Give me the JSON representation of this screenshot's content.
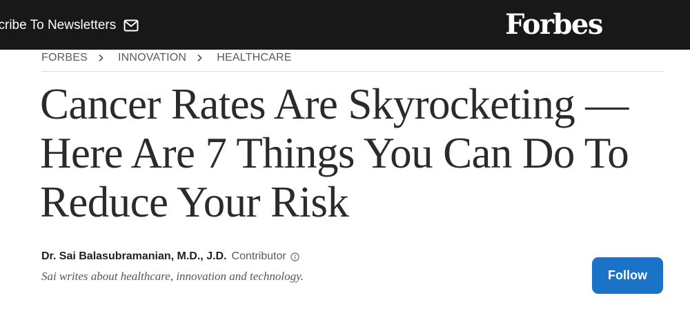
{
  "header": {
    "subscribe_label": "scribe To Newsletters",
    "mail_icon": "mail-icon",
    "logo_text": "Forbes"
  },
  "breadcrumb": {
    "items": [
      "FORBES",
      "INNOVATION",
      "HEALTHCARE"
    ],
    "separator_icon": "chevron-right-icon"
  },
  "article": {
    "headline": "Cancer Rates Are Skyrocketing — Here Are 7 Things You Can Do To Reduce Your Risk",
    "author_name": "Dr. Sai Balasubramanian, M.D., J.D.",
    "author_role": "Contributor",
    "info_icon": "info-icon",
    "author_bio": "Sai writes about healthcare, innovation and technology.",
    "follow_label": "Follow"
  },
  "colors": {
    "header_background": "#181818",
    "follow_button": "#1a73c7",
    "headline_text": "#2b2b2b"
  }
}
